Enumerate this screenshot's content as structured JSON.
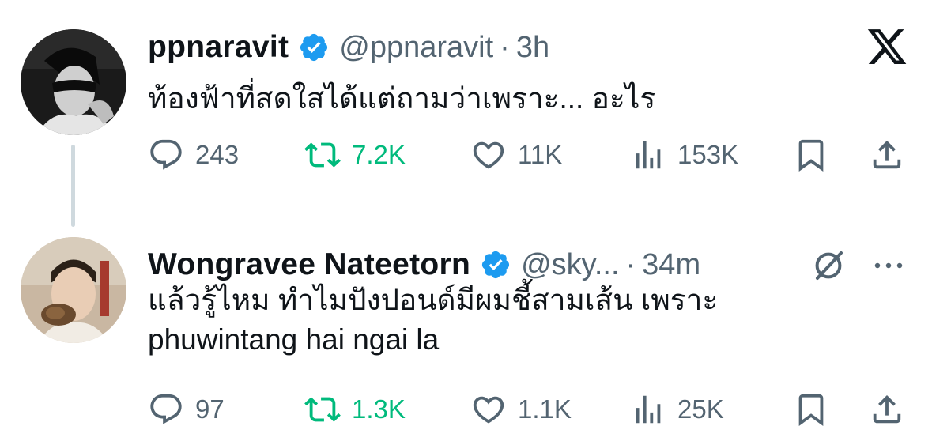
{
  "tweets": [
    {
      "display_name": "ppnaravit",
      "handle": "@ppnaravit",
      "separator": "·",
      "time": "3h",
      "text_lines": [
        "ท้องฟ้าที่สดใสได้แต่ถามว่าเพราะ... อะไร"
      ],
      "verified": true,
      "actions": {
        "replies": "243",
        "retweets": "7.2K",
        "likes": "11K",
        "views": "153K"
      }
    },
    {
      "display_name": "Wongravee Nateetorn",
      "handle": "@sky...",
      "separator": "·",
      "time": "34m",
      "text_lines": [
        "แล้วรู้ไหม ทำไมปังปอนด์มีผมชี้สามเส้น เพราะ",
        "phuwintang hai ngai la"
      ],
      "verified": true,
      "actions": {
        "replies": "97",
        "retweets": "1.3K",
        "likes": "1.1K",
        "views": "25K"
      }
    }
  ],
  "icons": {
    "verified": "verified-badge-icon",
    "reply": "reply-icon",
    "retweet": "retweet-icon",
    "like": "heart-icon",
    "views": "views-icon",
    "bookmark": "bookmark-icon",
    "share": "share-icon",
    "x_logo": "x-logo-icon",
    "grok": "grok-icon",
    "more": "more-icon"
  },
  "colors": {
    "text": "#0f1419",
    "secondary": "#536471",
    "verified": "#1d9bf0",
    "retweet": "#00ba7c",
    "thread_line": "#cfd9de"
  }
}
